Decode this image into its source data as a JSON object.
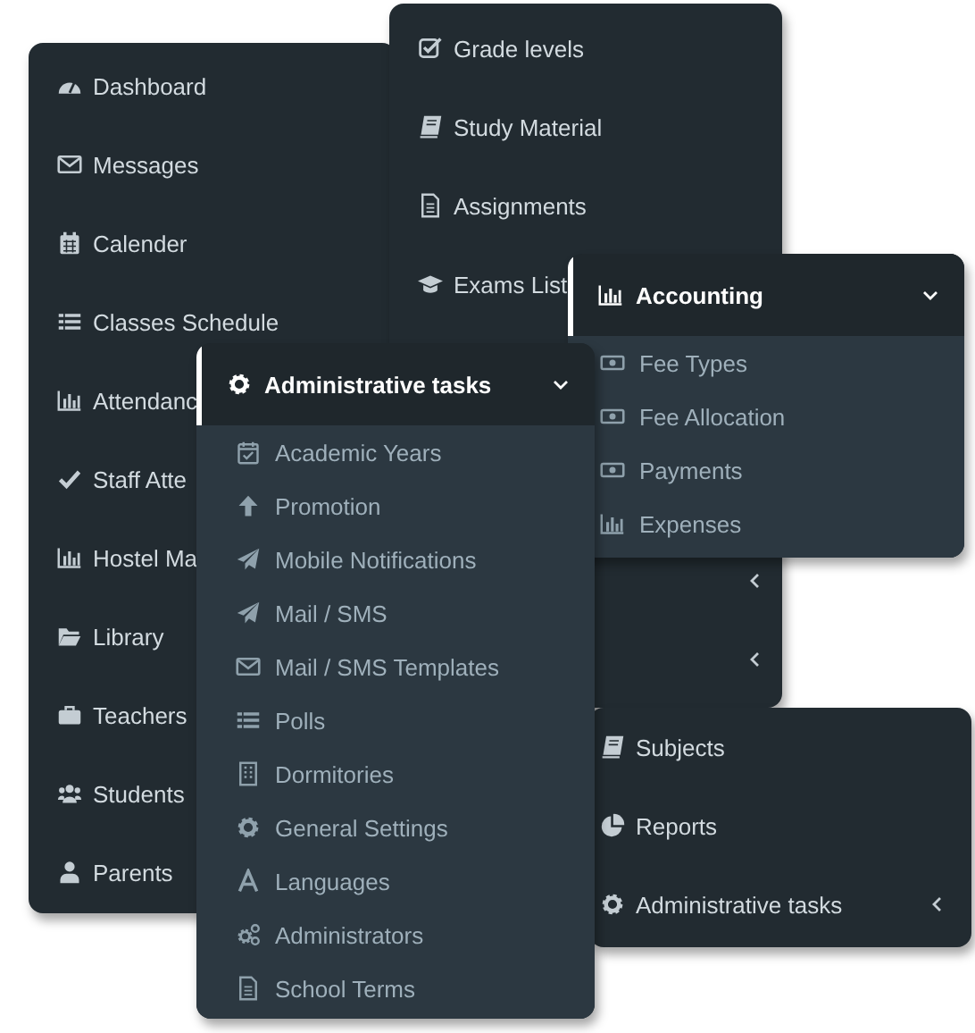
{
  "panels": [
    {
      "kind": "menu",
      "items": [
        {
          "label": "Dashboard"
        },
        {
          "label": "Messages"
        },
        {
          "label": "Calender"
        },
        {
          "label": "Classes Schedule"
        },
        {
          "label": "Attendanc"
        },
        {
          "label": "Staff Atte"
        },
        {
          "label": "Hostel Ma"
        },
        {
          "label": "Library"
        },
        {
          "label": "Teachers"
        },
        {
          "label": "Students"
        },
        {
          "label": "Parents"
        }
      ]
    },
    {
      "kind": "menu",
      "items": [
        {
          "label": "Grade levels"
        },
        {
          "label": "Study Material"
        },
        {
          "label": "Assignments"
        },
        {
          "label": "Exams List"
        }
      ],
      "lower_items": [
        {
          "has_submenu": true
        },
        {
          "has_submenu": true
        }
      ]
    },
    {
      "kind": "dropdown",
      "header": {
        "label": "Accounting",
        "expanded": true
      },
      "items": [
        {
          "label": "Fee Types"
        },
        {
          "label": "Fee Allocation"
        },
        {
          "label": "Payments"
        },
        {
          "label": "Expenses"
        }
      ]
    },
    {
      "kind": "menu",
      "items": [
        {
          "label": "Subjects",
          "has_submenu": false
        },
        {
          "label": "Reports",
          "has_submenu": false
        },
        {
          "label": "Administrative tasks",
          "has_submenu": true
        }
      ]
    },
    {
      "kind": "dropdown",
      "header": {
        "label": "Administrative tasks",
        "expanded": true
      },
      "items": [
        {
          "label": "Academic Years"
        },
        {
          "label": "Promotion"
        },
        {
          "label": "Mobile Notifications"
        },
        {
          "label": "Mail / SMS"
        },
        {
          "label": "Mail / SMS Templates"
        },
        {
          "label": "Polls"
        },
        {
          "label": "Dormitories"
        },
        {
          "label": "General Settings"
        },
        {
          "label": "Languages"
        },
        {
          "label": "Administrators"
        },
        {
          "label": "School Terms"
        }
      ]
    }
  ]
}
